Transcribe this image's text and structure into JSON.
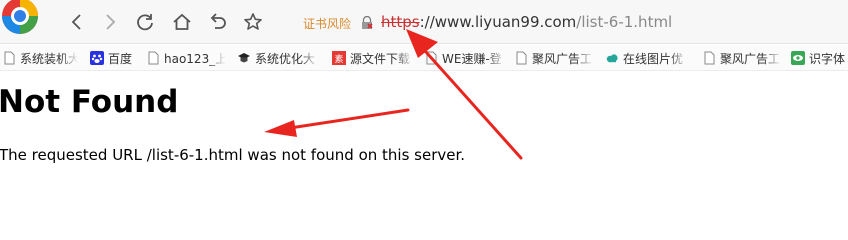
{
  "address_bar": {
    "cert_warning": "证书风险",
    "url_scheme": "https",
    "url_sep": "://",
    "url_host": "www.liyuan99.com",
    "url_path": "/list-6-1.html"
  },
  "toolbar_icons": {
    "logo": "browser-logo-icon",
    "back": "back-arrow-icon",
    "forward": "forward-arrow-icon",
    "refresh": "refresh-icon",
    "home": "home-icon",
    "undo": "undo-icon",
    "star": "star-icon",
    "lock": "broken-lock-icon"
  },
  "bookmarks": [
    {
      "label": "系统装机大",
      "icon": "file-icon"
    },
    {
      "label": "百度",
      "icon": "baidu-paw-icon"
    },
    {
      "label": "hao123_上",
      "icon": "file-icon"
    },
    {
      "label": "系统优化大",
      "icon": "graduation-cap-icon"
    },
    {
      "label": "源文件下载",
      "icon": "red-square-icon"
    },
    {
      "label": "WE速赚-登",
      "icon": "file-icon"
    },
    {
      "label": "聚风广告工",
      "icon": "file-icon"
    },
    {
      "label": "在线图片优",
      "icon": "cloud-icon"
    },
    {
      "label": "聚风广告工",
      "icon": "file-icon"
    },
    {
      "label": "识字体",
      "icon": "eye-icon"
    }
  ],
  "page": {
    "title": "Not Found",
    "message": "The requested URL /list-6-1.html was not found on this server."
  },
  "colors": {
    "warning": "#d98a2c",
    "insecure_scheme": "#c83232",
    "arrow": "#e8261f"
  }
}
